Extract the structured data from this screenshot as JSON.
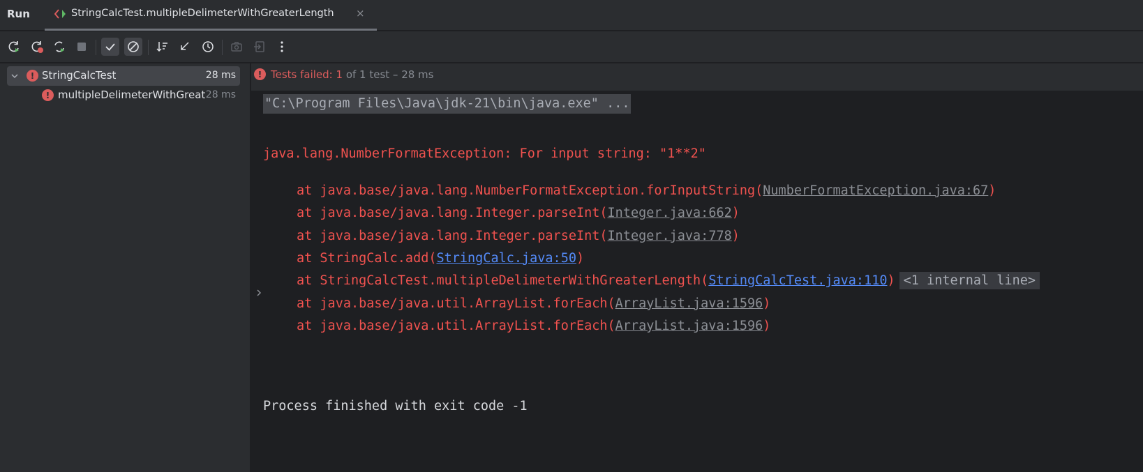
{
  "header": {
    "run_label": "Run",
    "tab_title": "StringCalcTest.multipleDelimeterWithGreaterLength",
    "tab_close": "×"
  },
  "toolbar": {
    "buttons": [
      "rerun-icon",
      "rerun-failed-icon",
      "toggle-auto-test-icon",
      "stop-icon",
      "show-passed-icon",
      "show-ignored-icon",
      "sort-alphabetically-icon",
      "collapse-all-icon",
      "test-history-icon",
      "screenshot-icon",
      "export-results-icon",
      "more-options-icon"
    ]
  },
  "tree": {
    "root": {
      "name": "StringCalcTest",
      "time": "28 ms"
    },
    "child": {
      "name": "multipleDelimeterWithGreat",
      "time": "28 ms"
    }
  },
  "status": {
    "failed_label": "Tests failed: 1",
    "rest_label": " of 1 test – 28 ms"
  },
  "console": {
    "command": "\"C:\\Program Files\\Java\\jdk-21\\bin\\java.exe\" ...",
    "exception": "java.lang.NumberFormatException: For input string: \"1**2\"",
    "stack": [
      {
        "prefix": "at java.base/java.lang.NumberFormatException.forInputString(",
        "link": "NumberFormatException.java:67",
        "link_style": "gray",
        "suffix": ")",
        "internal": ""
      },
      {
        "prefix": "at java.base/java.lang.Integer.parseInt(",
        "link": "Integer.java:662",
        "link_style": "gray",
        "suffix": ")",
        "internal": ""
      },
      {
        "prefix": "at java.base/java.lang.Integer.parseInt(",
        "link": "Integer.java:778",
        "link_style": "gray",
        "suffix": ")",
        "internal": ""
      },
      {
        "prefix": "at StringCalc.add(",
        "link": "StringCalc.java:50",
        "link_style": "blue",
        "suffix": ")",
        "internal": ""
      },
      {
        "prefix": "at StringCalcTest.multipleDelimeterWithGreaterLength(",
        "link": "StringCalcTest.java:110",
        "link_style": "blue",
        "suffix": ")",
        "internal": "<1 internal line>"
      },
      {
        "prefix": "at java.base/java.util.ArrayList.forEach(",
        "link": "ArrayList.java:1596",
        "link_style": "gray",
        "suffix": ")",
        "internal": ""
      },
      {
        "prefix": "at java.base/java.util.ArrayList.forEach(",
        "link": "ArrayList.java:1596",
        "link_style": "gray",
        "suffix": ")",
        "internal": ""
      }
    ],
    "finish": "Process finished with exit code -1"
  },
  "colors": {
    "error_red": "#f0524f",
    "link_blue": "#548af7",
    "background": "#1e1f22",
    "panel": "#2b2d30"
  }
}
